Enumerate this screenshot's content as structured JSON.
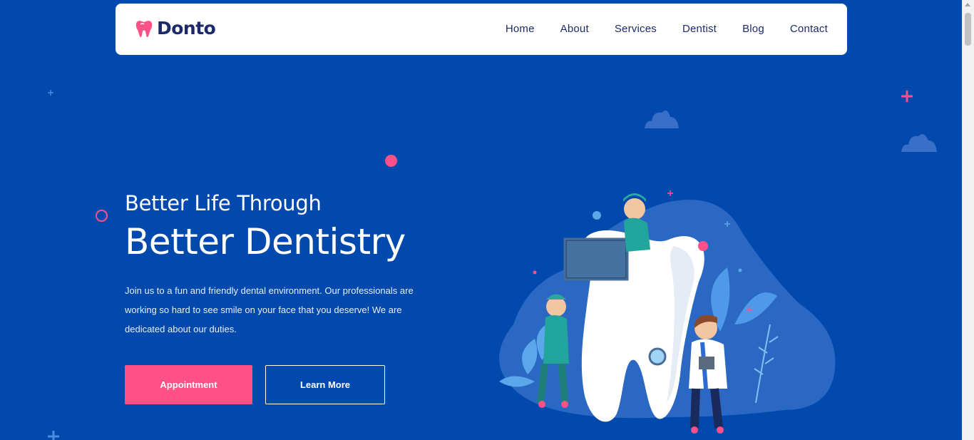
{
  "brand": {
    "name": "Donto"
  },
  "nav": {
    "items": [
      "Home",
      "About",
      "Services",
      "Dentist",
      "Blog",
      "Contact"
    ]
  },
  "hero": {
    "subtitle": "Better Life Through",
    "title": "Better Dentistry",
    "description": "Join us to a fun and friendly dental environment. Our professionals are working so hard to see smile on your face that you deserve! We are dedicated about our duties.",
    "primary_button": "Appointment",
    "secondary_button": "Learn More"
  },
  "colors": {
    "background": "#0149ad",
    "accent": "#ff5087",
    "navbar_text": "#1c2a6b"
  },
  "icons": {
    "logo": "tooth-icon"
  }
}
